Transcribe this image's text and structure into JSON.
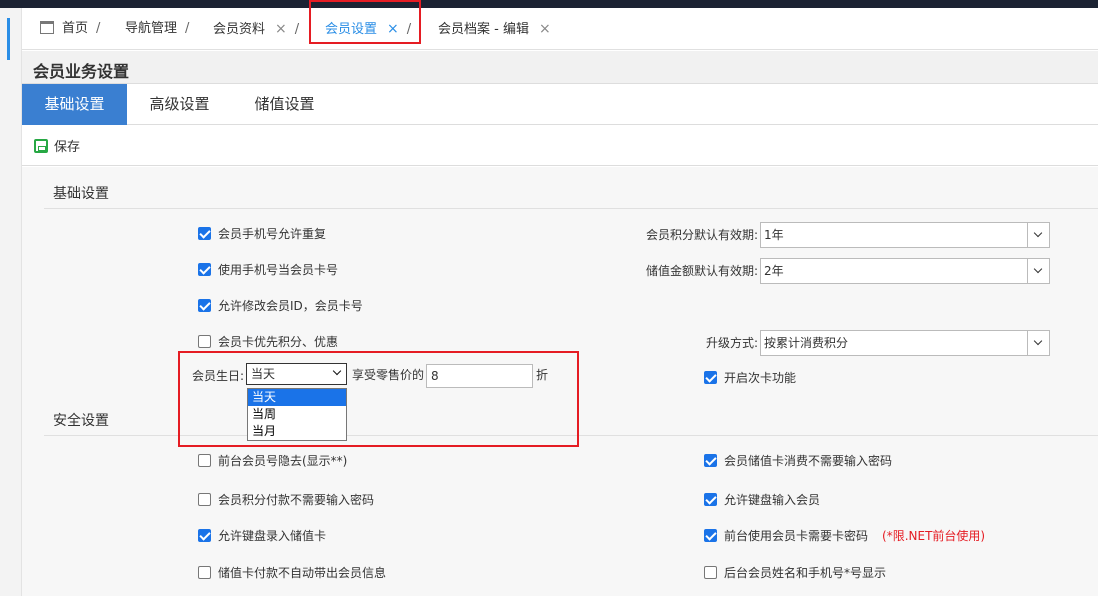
{
  "breadcrumb": {
    "tabs": [
      {
        "label": "首页",
        "closable": false,
        "active": false
      },
      {
        "label": "导航管理",
        "closable": false,
        "active": false
      },
      {
        "label": "会员资料",
        "closable": true,
        "active": false
      },
      {
        "label": "会员设置",
        "closable": true,
        "active": true
      },
      {
        "label": "会员档案 - 编辑",
        "closable": true,
        "active": false
      }
    ],
    "separator": "/",
    "close_glyph": "×"
  },
  "panel": {
    "title": "会员业务设置"
  },
  "subtabs": [
    {
      "label": "基础设置",
      "active": true
    },
    {
      "label": "高级设置",
      "active": false
    },
    {
      "label": "储值设置",
      "active": false
    }
  ],
  "toolbar": {
    "save_label": "保存"
  },
  "basic": {
    "title": "基础设置",
    "options": [
      {
        "label": "会员手机号允许重复",
        "checked": true
      },
      {
        "label": "使用手机号当会员卡号",
        "checked": true
      },
      {
        "label": "允许修改会员ID，会员卡号",
        "checked": true
      },
      {
        "label": "会员卡优先积分、优惠",
        "checked": false
      }
    ],
    "points_validity": {
      "label": "会员积分默认有效期:",
      "value": "1年"
    },
    "stored_validity": {
      "label": "储值金额默认有效期:",
      "value": "2年"
    },
    "upgrade": {
      "label": "升级方式:",
      "value": "按累计消费积分"
    },
    "birthday": {
      "label": "会员生日:",
      "selected": "当天",
      "options": [
        "当天",
        "当周",
        "当月"
      ],
      "discount_label": "享受零售价的",
      "discount_value": "8",
      "discount_unit": "折"
    },
    "count_card": {
      "label": "开启次卡功能",
      "checked": true
    }
  },
  "security": {
    "title": "安全设置",
    "left": [
      {
        "label": "前台会员号隐去(显示**)",
        "checked": false
      },
      {
        "label": "会员积分付款不需要输入密码",
        "checked": false
      },
      {
        "label": "允许键盘录入储值卡",
        "checked": true
      },
      {
        "label": "储值卡付款不自动带出会员信息",
        "checked": false
      }
    ],
    "right": [
      {
        "label": "会员储值卡消费不需要输入密码",
        "checked": true
      },
      {
        "label": "允许键盘输入会员",
        "checked": true
      },
      {
        "label": "前台使用会员卡需要卡密码",
        "checked": true,
        "note": "(*限.NET前台使用)"
      },
      {
        "label": "后台会员姓名和手机号*号显示",
        "checked": false
      }
    ]
  },
  "colors": {
    "accent": "#3a7fd1",
    "highlight": "#e51c23",
    "checkbox": "#1a73e8",
    "save_icon": "#27a844"
  }
}
